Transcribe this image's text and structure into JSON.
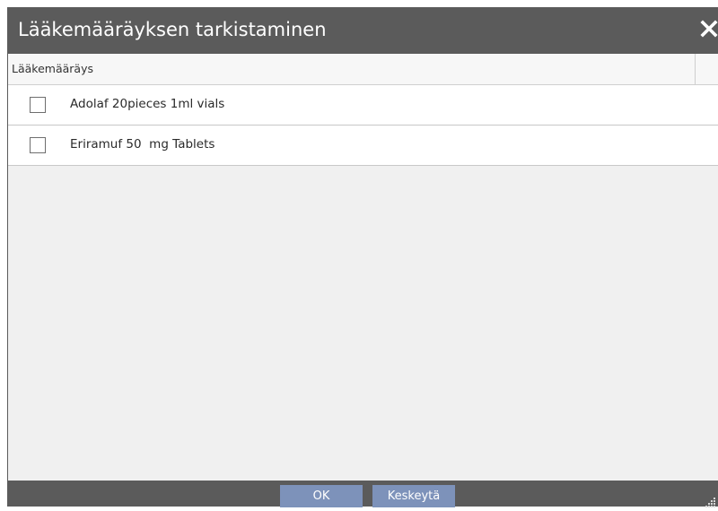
{
  "dialog": {
    "title": "Lääkemääräyksen tarkistaminen",
    "close_icon": "close-icon"
  },
  "grid": {
    "column_header": "Lääkemääräys",
    "rows": [
      {
        "label": "Adolaf 20pieces 1ml vials",
        "checked": false
      },
      {
        "label": "Eriramuf 50  mg Tablets",
        "checked": false
      }
    ]
  },
  "footer": {
    "ok_label": "OK",
    "cancel_label": "Keskeytä",
    "resize_icon": "resize-grip-icon"
  },
  "colors": {
    "frame": "#5b5b5b",
    "button": "#7d92ba",
    "content_bg": "#f0f0f0"
  }
}
